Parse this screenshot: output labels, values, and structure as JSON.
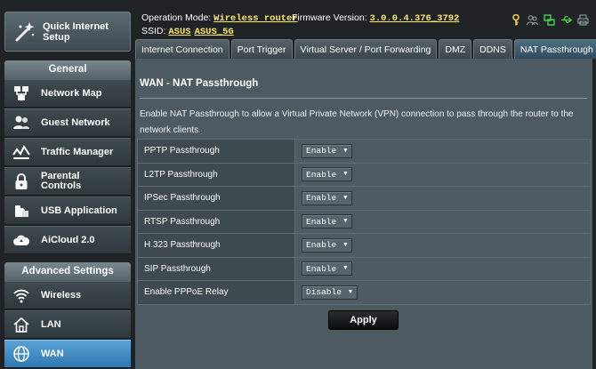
{
  "sidebar": {
    "quick_setup_label_1": "Quick Internet",
    "quick_setup_label_2": "Setup",
    "general_header": "General",
    "general_items": [
      {
        "label": "Network Map",
        "icon": "network-map-icon"
      },
      {
        "label": "Guest Network",
        "icon": "guest-network-icon"
      },
      {
        "label": "Traffic Manager",
        "icon": "traffic-manager-icon"
      },
      {
        "label_1": "Parental",
        "label_2": "Controls",
        "icon": "lock-icon"
      },
      {
        "label": "USB Application",
        "icon": "usb-icon"
      },
      {
        "label": "AiCloud 2.0",
        "icon": "cloud-icon"
      }
    ],
    "advanced_header": "Advanced Settings",
    "advanced_items": [
      {
        "label": "Wireless",
        "icon": "wifi-icon"
      },
      {
        "label": "LAN",
        "icon": "home-icon"
      },
      {
        "label": "WAN",
        "icon": "globe-icon",
        "active": true
      }
    ]
  },
  "status": {
    "op_mode_label": "Operation Mode:",
    "op_mode_value": "Wireless router",
    "fw_label": "Firmware Version:",
    "fw_value": "3.0.0.4.376_3792",
    "ssid_label": "SSID:",
    "ssid_1": "ASUS",
    "ssid_2": "ASUS_5G",
    "icons": [
      "key-icon",
      "users-icon",
      "network-icon",
      "usb-status-icon",
      "printer-icon"
    ]
  },
  "tabs": [
    "Internet Connection",
    "Port Trigger",
    "Virtual Server / Port Forwarding",
    "DMZ",
    "DDNS",
    "NAT Passthrough"
  ],
  "active_tab": "NAT Passthrough",
  "page": {
    "title": "WAN - NAT Passthrough",
    "description": "Enable NAT Passthrough to allow a Virtual Private Network (VPN) connection to pass through the router to the network clients.",
    "rows": [
      {
        "label": "PPTP Passthrough",
        "value": "Enable"
      },
      {
        "label": "L2TP Passthrough",
        "value": "Enable"
      },
      {
        "label": "IPSec Passthrough",
        "value": "Enable"
      },
      {
        "label": "RTSP Passthrough",
        "value": "Enable"
      },
      {
        "label": "H.323 Passthrough",
        "value": "Enable"
      },
      {
        "label": "SIP Passthrough",
        "value": "Enable"
      },
      {
        "label": "Enable PPPoE Relay",
        "value": "Disable"
      }
    ],
    "apply_label": "Apply"
  },
  "colors": {
    "accent_yellow": "#ffe86a",
    "active_blue": "#2f78b2",
    "panel_bg": "#4d5a61"
  }
}
